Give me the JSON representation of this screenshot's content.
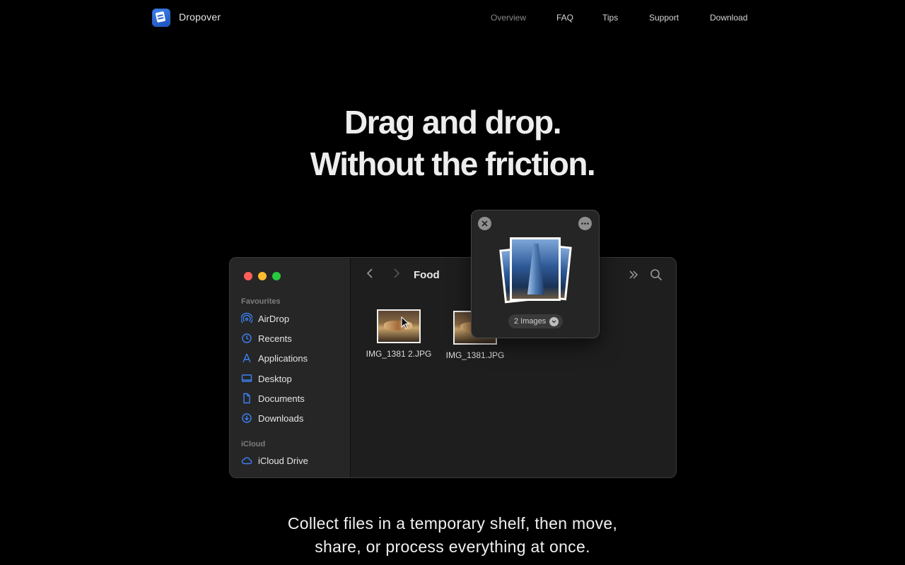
{
  "header": {
    "brand": "Dropover",
    "nav": [
      "Overview",
      "FAQ",
      "Tips",
      "Support",
      "Download"
    ]
  },
  "hero": {
    "line1": "Drag and drop.",
    "line2": "Without the friction."
  },
  "finder": {
    "folder_title": "Food",
    "sections": {
      "favourites": "Favourites",
      "icloud": "iCloud"
    },
    "sidebar_items": [
      "AirDrop",
      "Recents",
      "Applications",
      "Desktop",
      "Documents",
      "Downloads"
    ],
    "icloud_items": [
      "iCloud Drive"
    ],
    "files": [
      "IMG_1381 2.JPG",
      "IMG_1381.JPG"
    ],
    "accent_color": "#3b82f6"
  },
  "shelf": {
    "count_label": "2 Images"
  },
  "tagline": {
    "line1": "Collect files in a temporary shelf, then move,",
    "line2": "share, or process everything at once."
  },
  "colors": {
    "background": "#000000",
    "close": "#ff5f57",
    "minimize": "#febc2e",
    "zoom": "#28c840"
  }
}
